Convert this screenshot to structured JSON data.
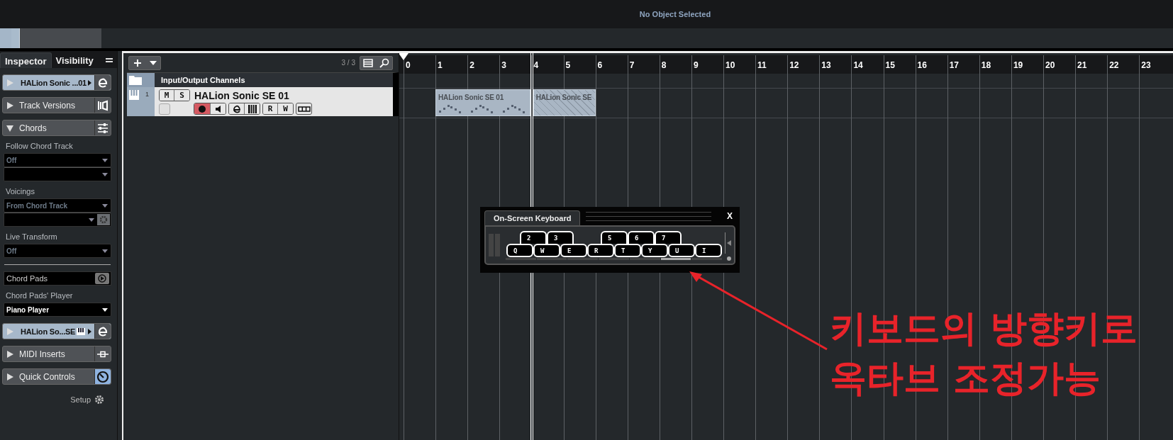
{
  "header": {
    "title": "No Object Selected"
  },
  "inspector": {
    "tabs": [
      {
        "label": "Inspector",
        "selected": true
      },
      {
        "label": "Visibility",
        "selected": false
      }
    ],
    "sections": [
      {
        "kind": "track",
        "label": "HALion Sonic ...01",
        "expanded": false,
        "active": false
      },
      {
        "kind": "section",
        "label": "Track Versions",
        "expanded": false,
        "active": false
      },
      {
        "kind": "section",
        "label": "Chords",
        "expanded": true,
        "active": false,
        "fields": [
          {
            "kind": "label",
            "text": "Follow Chord Track"
          },
          {
            "kind": "dropdown",
            "value": "Off",
            "disabled": true
          },
          {
            "kind": "dropdown",
            "disabled": true,
            "joined": true
          },
          {
            "kind": "label",
            "text": "Voicings"
          },
          {
            "kind": "dropdown",
            "value": "From Chord Track",
            "disabled": true
          },
          {
            "kind": "dropdown",
            "disabled": true,
            "joined": true,
            "gear": true
          },
          {
            "kind": "label",
            "text": "Live Transform"
          },
          {
            "kind": "dropdown",
            "value": "Off",
            "disabled": true
          },
          {
            "kind": "divider"
          },
          {
            "kind": "pads",
            "text": "Chord Pads"
          },
          {
            "kind": "label",
            "text": "Chord Pads' Player"
          },
          {
            "kind": "dropdown",
            "value": "Piano Player",
            "disabled": false
          }
        ]
      },
      {
        "kind": "track",
        "label": "HALion So...SE",
        "expanded": false,
        "active": false
      },
      {
        "kind": "section",
        "label": "MIDI Inserts",
        "expanded": false,
        "active": false
      },
      {
        "kind": "section",
        "label": "Quick Controls",
        "expanded": false,
        "active": true
      }
    ],
    "setup": "Setup"
  },
  "tracklist": {
    "count": "3 / 3",
    "folder": {
      "name": "Input/Output Channels"
    },
    "tracks": [
      {
        "number": "1",
        "name": "HALion Sonic SE 01",
        "selected": true,
        "record_enabled": true,
        "mute": "M",
        "solo": "S",
        "read": "R",
        "write": "W"
      }
    ]
  },
  "ruler": {
    "bars": [
      "0",
      "1",
      "2",
      "3",
      "4",
      "5",
      "6",
      "7",
      "8",
      "9",
      "10",
      "11",
      "12",
      "13",
      "14",
      "15",
      "16",
      "17",
      "18",
      "19",
      "20",
      "21",
      "22",
      "23"
    ]
  },
  "parts": [
    {
      "label": "HALion Sonic SE 01",
      "hatched": false
    },
    {
      "label": "HALion Sonic SE",
      "hatched": true
    }
  ],
  "keyboard": {
    "title": "On-Screen Keyboard",
    "close": "X",
    "upper_keys": [
      {
        "kind": "key",
        "label": "2"
      },
      {
        "kind": "key",
        "label": "3"
      },
      {
        "kind": "gap"
      },
      {
        "kind": "key",
        "label": "5"
      },
      {
        "kind": "key",
        "label": "6"
      },
      {
        "kind": "key",
        "label": "7"
      }
    ],
    "lower_keys": [
      "Q",
      "W",
      "E",
      "R",
      "T",
      "Y",
      "U",
      "I"
    ],
    "octaves": [
      {
        "selected": false
      },
      {
        "selected": false
      },
      {
        "selected": false
      },
      {
        "selected": false
      },
      {
        "selected": false
      },
      {
        "selected": true
      },
      {
        "selected": false
      }
    ]
  },
  "annotation": {
    "lines": [
      "키보드의 방향키로",
      "옥타브 조정가능"
    ],
    "color": "#e8232a"
  }
}
